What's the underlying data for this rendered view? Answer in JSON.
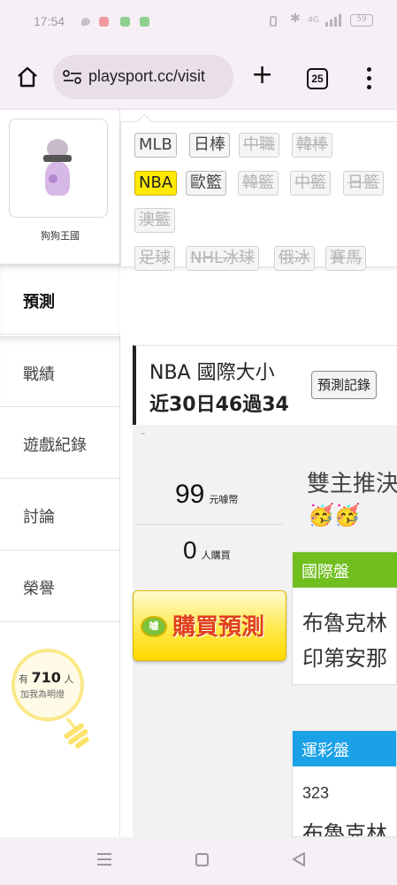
{
  "status_bar": {
    "time": "17:54",
    "battery": "59",
    "network": "4G"
  },
  "browser": {
    "url": "playsport.cc/visit",
    "tab_count": "25"
  },
  "profile": {
    "name": "狗狗王國"
  },
  "sidebar": {
    "items": [
      {
        "label": "預測",
        "active": true
      },
      {
        "label": "戰績"
      },
      {
        "label": "遊戲紀錄"
      },
      {
        "label": "討論"
      },
      {
        "label": "榮譽"
      }
    ],
    "fans": {
      "prefix": "有",
      "count": "710",
      "suffix": "人",
      "caption": "加我為明燈"
    }
  },
  "leagues": {
    "row1": [
      {
        "label": "MLB",
        "state": "on"
      },
      {
        "label": "日棒",
        "state": "on"
      },
      {
        "label": "中職",
        "state": "off"
      },
      {
        "label": "韓棒",
        "state": "off"
      }
    ],
    "row2": [
      {
        "label": "NBA",
        "state": "active"
      },
      {
        "label": "歐籃",
        "state": "on"
      },
      {
        "label": "韓籃",
        "state": "off"
      },
      {
        "label": "中籃",
        "state": "off"
      },
      {
        "label": "日籃",
        "state": "off"
      }
    ],
    "row3": [
      {
        "label": "澳籃",
        "state": "off"
      }
    ],
    "row4": [
      {
        "label": "足球",
        "state": "off"
      },
      {
        "label": "NHL冰球",
        "state": "off"
      },
      {
        "label": "俄冰",
        "state": "off"
      },
      {
        "label": "賽馬",
        "state": "off"
      }
    ]
  },
  "header_card": {
    "title": "NBA 國際大小",
    "record": "近30日46過34",
    "history_button": "預測記錄"
  },
  "purchase": {
    "price": "99",
    "price_unit": "元噱幣",
    "buyers": "0",
    "buyers_unit": "人購買",
    "buy_button": "購買預測",
    "badge": "噱"
  },
  "recommend": {
    "title": "雙主推決",
    "emoji": "🥳🥳"
  },
  "intl_market": {
    "label": "國際盤",
    "lines": [
      "布魯克林",
      "印第安那"
    ]
  },
  "lottery_market": {
    "label": "運彩盤",
    "code": "323",
    "line": "布魯克林"
  },
  "colors": {
    "accent_green": "#71bf1f",
    "accent_blue": "#1aa1e6",
    "nba_yellow": "#ffea00"
  }
}
